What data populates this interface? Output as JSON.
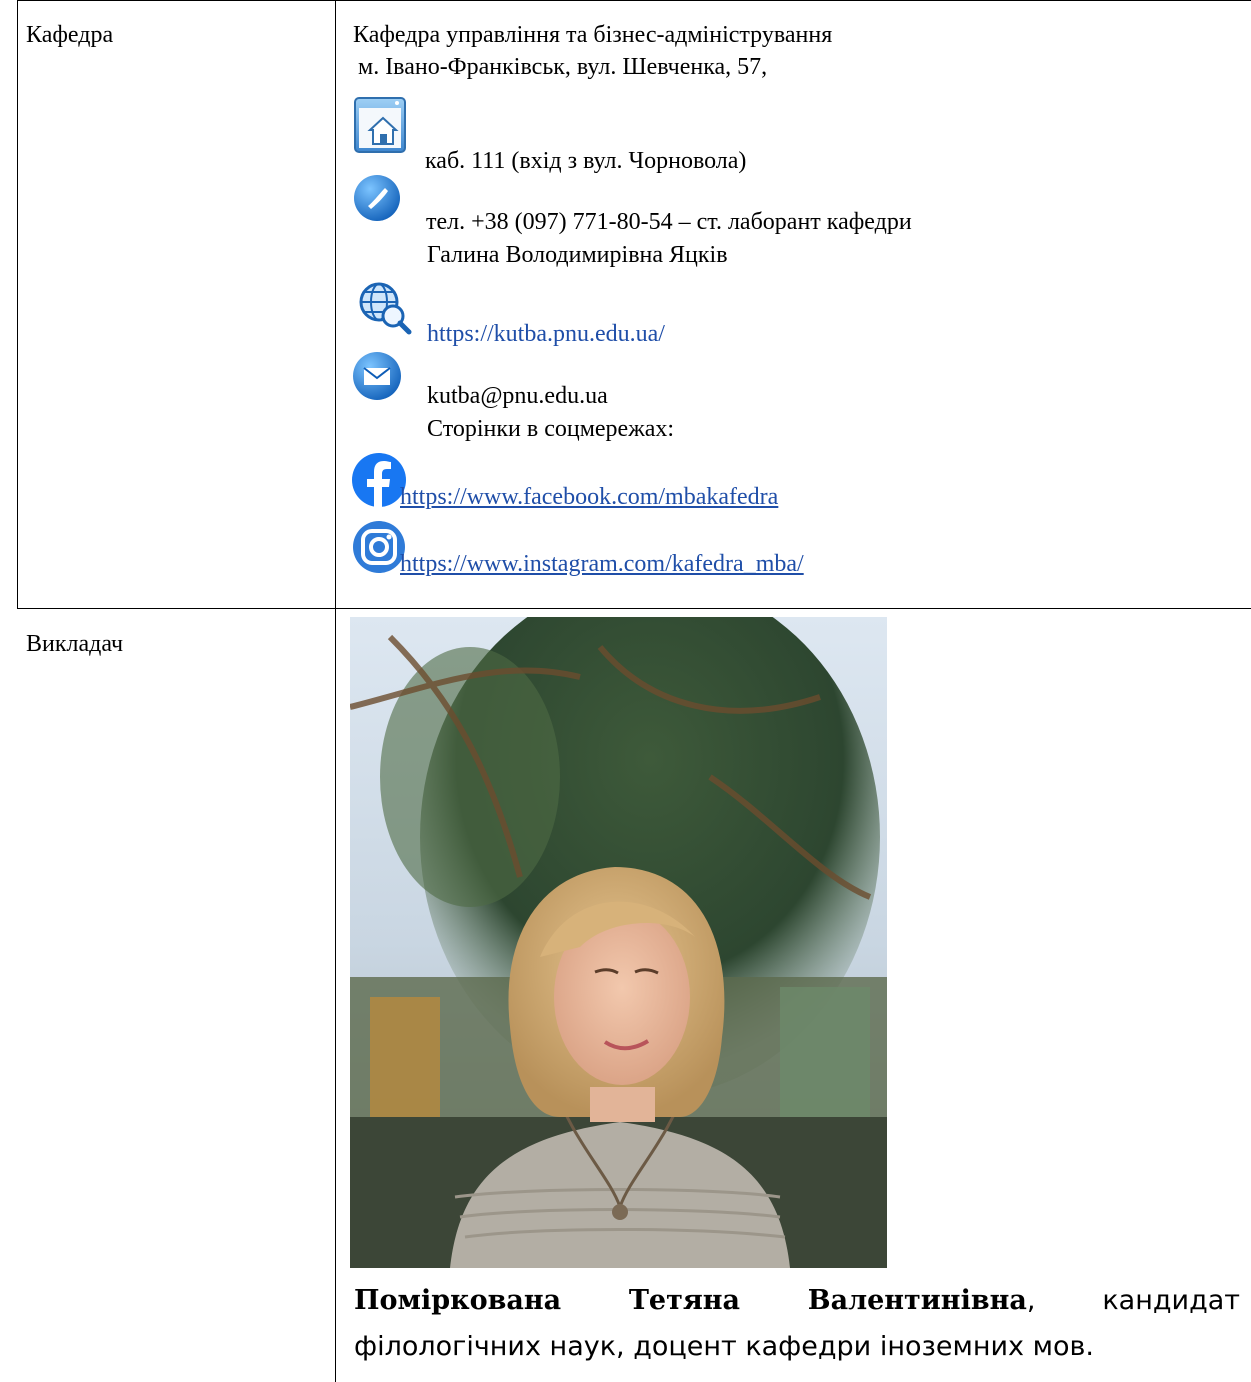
{
  "department": {
    "row_label": "Кафедра",
    "name": "Кафедра управління та бізнес-адміністрування",
    "address": "м. Івано-Франківськ, вул. Шевченка, 57,",
    "room": "каб. 111 (вхід з вул. Чорновола)",
    "phone": "тел. +38 (097) 771-80-54 –  ст. лаборант кафедри",
    "phone_person": "Галина Володимирівна Яцків",
    "website": "https://kutba.pnu.edu.ua/",
    "email": "kutba@pnu.edu.ua",
    "social_label": "Сторінки в соцмережах:",
    "facebook": "https://www.facebook.com/mbakafedra",
    "instagram": "https://www.instagram.com/kafedra_mba/"
  },
  "teacher": {
    "row_label": "Викладач",
    "name": "Поміркована Тетяна Валентинівна",
    "description": ", кандидат філологічних наук, доцент кафедри іноземних мов."
  },
  "colors": {
    "link": "#1f4ea8",
    "facebook": "#1877f2",
    "icon_blue": "#2b7fd6"
  },
  "icons": [
    "home-window-icon",
    "phone-icon",
    "globe-search-icon",
    "envelope-icon",
    "facebook-icon",
    "instagram-icon"
  ]
}
